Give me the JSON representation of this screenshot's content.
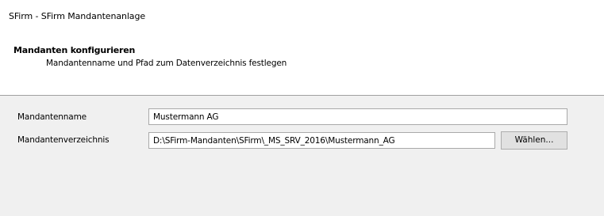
{
  "window": {
    "title": "SFirm - SFirm Mandantenanlage"
  },
  "header": {
    "title": "Mandanten konfigurieren",
    "subtitle": "Mandantenname und Pfad zum Datenverzeichnis festlegen"
  },
  "form": {
    "mandantenname": {
      "label": "Mandantenname",
      "value": "Mustermann AG"
    },
    "mandantenverzeichnis": {
      "label": "Mandantenverzeichnis",
      "value": "D:\\SFirm-Mandanten\\SFirm\\_MS_SRV_2016\\Mustermann_AG"
    },
    "browse_button_label": "Wählen..."
  }
}
